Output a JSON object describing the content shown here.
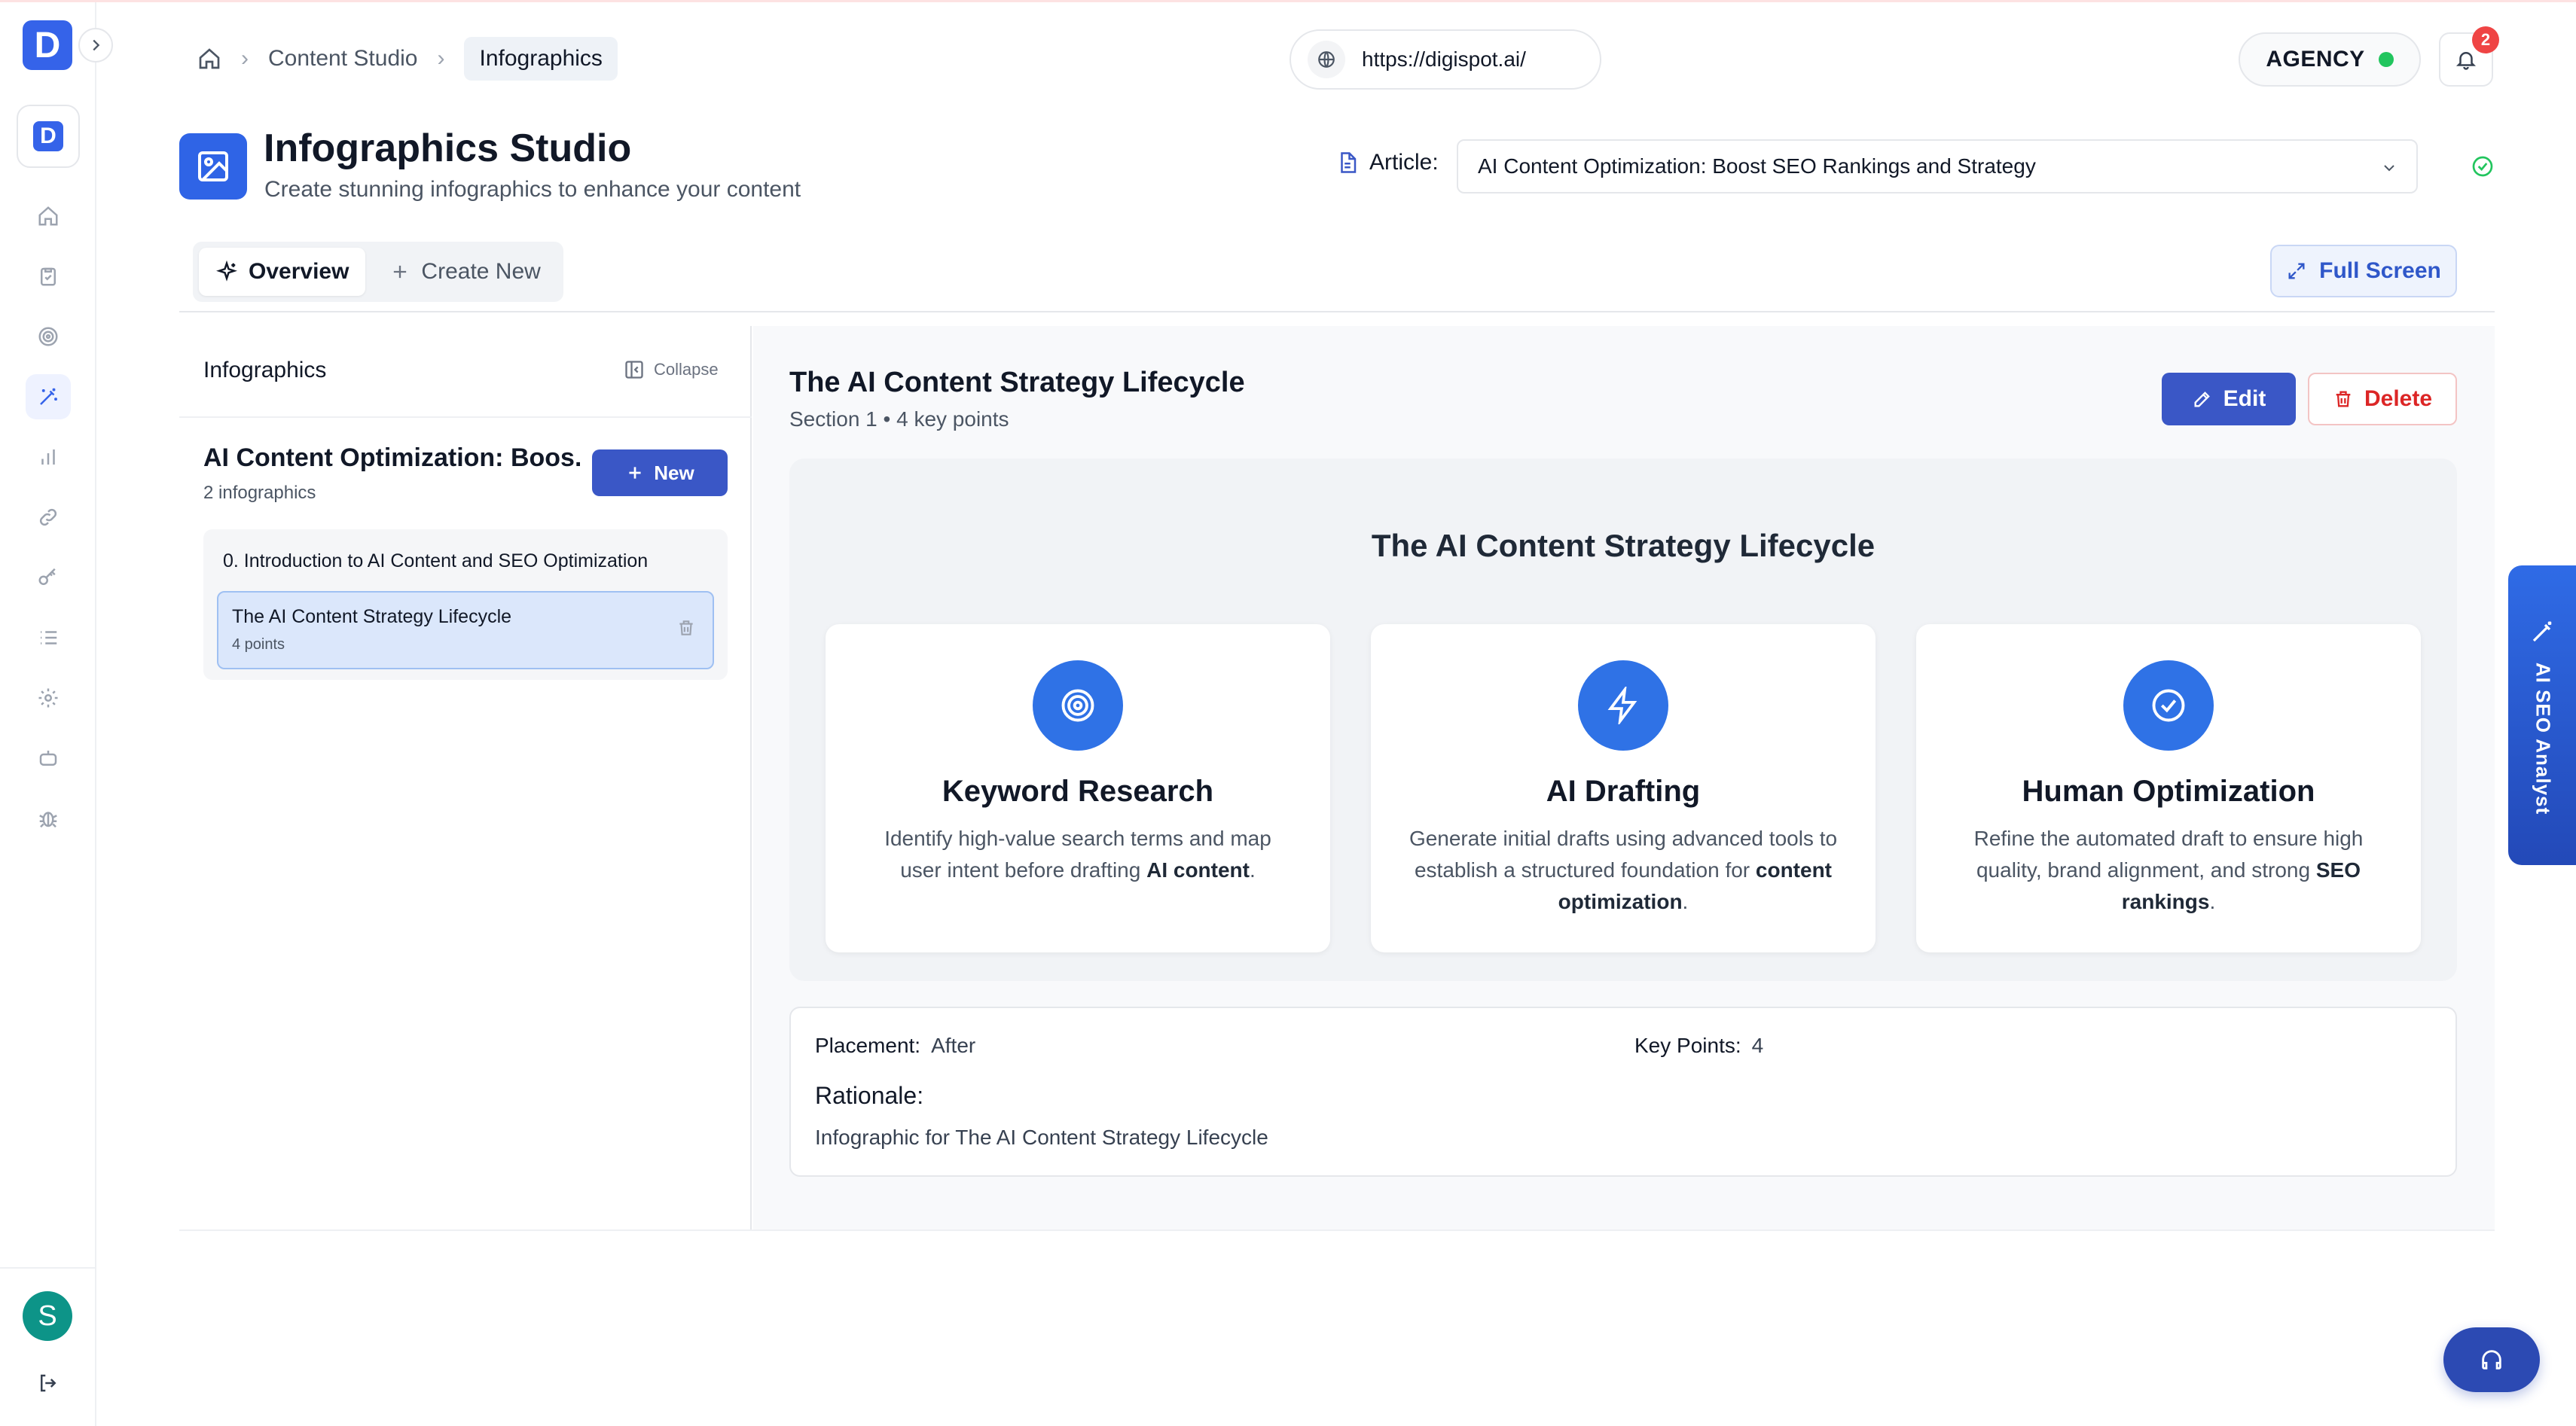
{
  "brand": {
    "logo_letter": "D",
    "app_letter": "D"
  },
  "user": {
    "avatar_initial": "S"
  },
  "breadcrumb": {
    "items": [
      "Content Studio"
    ],
    "current": "Infographics"
  },
  "url": "https://digispot.ai/",
  "plan_badge": "AGENCY",
  "notifications": {
    "count": "2"
  },
  "header": {
    "title": "Infographics Studio",
    "subtitle": "Create stunning infographics to enhance your content",
    "article_label": "Article:",
    "article_value": "AI Content Optimization: Boost SEO Rankings and Strategy"
  },
  "tabs": [
    {
      "label": "Overview",
      "active": true
    },
    {
      "label": "Create New",
      "active": false
    }
  ],
  "fullscreen_label": "Full Screen",
  "sidebar_panel": {
    "title": "Infographics",
    "collapse_label": "Collapse",
    "article_title": "AI Content Optimization: Boos...",
    "article_count": "2 infographics",
    "new_label": "New",
    "section_title": "0. Introduction to AI Content and SEO Optimization",
    "item": {
      "title": "The AI Content Strategy Lifecycle",
      "sub": "4 points"
    }
  },
  "main": {
    "title": "The AI Content Strategy Lifecycle",
    "subtitle": "Section 1 • 4 key points",
    "edit_label": "Edit",
    "delete_label": "Delete",
    "infographic_title": "The AI Content Strategy Lifecycle",
    "features": [
      {
        "icon": "target-icon",
        "title": "Keyword Research",
        "desc_parts": [
          "Identify high-value search terms and map user intent before drafting ",
          "AI content",
          "."
        ]
      },
      {
        "icon": "lightning-icon",
        "title": "AI Drafting",
        "desc_parts": [
          "Generate initial drafts using advanced tools to establish a structured foundation for ",
          "content optimization",
          "."
        ]
      },
      {
        "icon": "check-circle-icon",
        "title": "Human Optimization",
        "desc_parts": [
          "Refine the automated draft to ensure high quality, brand alignment, and strong ",
          "SEO rankings",
          "."
        ]
      }
    ],
    "placement_label": "Placement:",
    "placement_value": "After",
    "keypoints_label": "Key Points:",
    "keypoints_value": "4",
    "rationale_label": "Rationale:",
    "rationale_text": "Infographic for The AI Content Strategy Lifecycle"
  },
  "analyst_tab": "AI SEO Analyst",
  "colors": {
    "accent": "#3a57c6",
    "brand": "#3563e9",
    "danger": "#dc2626",
    "success": "#22c55e"
  }
}
